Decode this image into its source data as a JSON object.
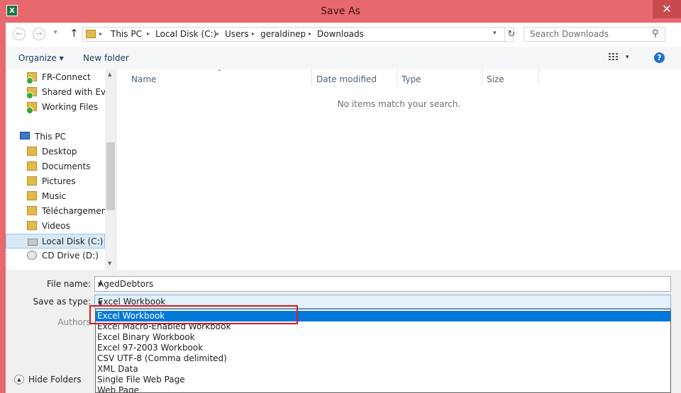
{
  "window": {
    "title": "Save As",
    "app_icon": "X",
    "close_glyph": "✕"
  },
  "nav": {
    "back_glyph": "←",
    "forward_glyph": "→",
    "recent_glyph": "▾",
    "up_glyph": "↑",
    "breadcrumb": [
      "This PC",
      "Local Disk (C:)",
      "Users",
      "geraldinep",
      "Downloads"
    ],
    "separator": "▸",
    "dropdown_glyph": "▾",
    "refresh_glyph": "↻",
    "search_placeholder": "Search Downloads",
    "search_glyph": "⚲"
  },
  "toolbar": {
    "organize_label": "Organize",
    "organize_chevron": "▾",
    "new_folder_label": "New folder",
    "view_chevron": "▾",
    "help_glyph": "?"
  },
  "sidebar": {
    "items": [
      {
        "label": "FR-Connect",
        "icon": "shared-folder-icon"
      },
      {
        "label": "Shared with Every",
        "icon": "shared-folder-icon"
      },
      {
        "label": "Working Files",
        "icon": "shared-folder-icon"
      },
      {
        "label": "This PC",
        "icon": "computer-icon"
      },
      {
        "label": "Desktop",
        "icon": "folder-icon"
      },
      {
        "label": "Documents",
        "icon": "folder-icon"
      },
      {
        "label": "Pictures",
        "icon": "folder-icon"
      },
      {
        "label": "Music",
        "icon": "folder-icon"
      },
      {
        "label": "Téléchargements",
        "icon": "folder-icon"
      },
      {
        "label": "Videos",
        "icon": "folder-icon"
      },
      {
        "label": "Local Disk (C:)",
        "icon": "drive-icon",
        "selected": true
      },
      {
        "label": "CD Drive (D:)",
        "icon": "cd-drive-icon"
      }
    ],
    "scroll_up_glyph": "▲",
    "scroll_down_glyph": "▼"
  },
  "filelist": {
    "columns": [
      "Name",
      "Date modified",
      "Type",
      "Size"
    ],
    "sort_glyph": "^",
    "empty_message": "No items match your search."
  },
  "form": {
    "file_name_label": "File name:",
    "file_name_value": "AgedDebtors",
    "save_as_type_label": "Save as type:",
    "save_as_type_value": "Excel Workbook",
    "authors_label": "Authors",
    "combo_chevron": "▾",
    "type_options": [
      "Excel Workbook",
      "Excel Macro-Enabled Workbook",
      "Excel Binary Workbook",
      "Excel 97-2003 Workbook",
      "CSV UTF-8 (Comma delimited)",
      "XML Data",
      "Single File Web Page",
      "Web Page"
    ],
    "selected_option": 0
  },
  "footer": {
    "hide_folders_label": "Hide Folders",
    "hide_folders_glyph": "▲"
  },
  "colors": {
    "titlebar": "#e8686f",
    "selection": "#0078d7",
    "highlight_box": "#e0141e"
  }
}
